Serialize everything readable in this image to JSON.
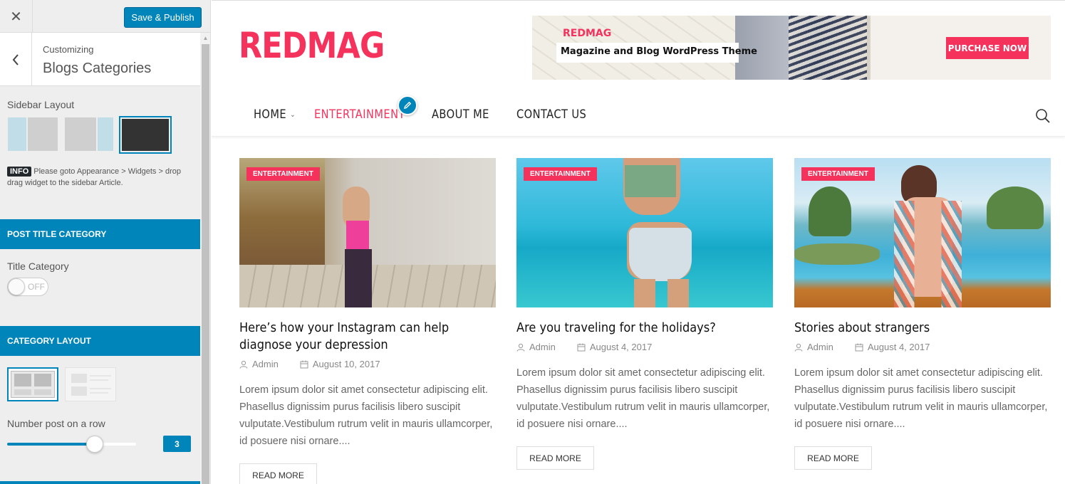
{
  "customizer": {
    "close_icon": "✕",
    "publish_label": "Save & Publish",
    "breadcrumb": "Customizing",
    "section_title": "Blogs Categories",
    "sidebar_layout": {
      "title": "Sidebar Layout",
      "options": [
        "left-sidebar",
        "right-sidebar",
        "no-sidebar"
      ],
      "selected": "no-sidebar"
    },
    "info": {
      "badge": "INFO",
      "text": "Please goto Appearance > Widgets > drop drag widget to the sidebar Article."
    },
    "post_title_category": {
      "heading": "POST TITLE CATEGORY",
      "control_title": "Title Category",
      "toggle_label": "OFF",
      "toggle_on": false
    },
    "category_layout": {
      "heading": "CATEGORY LAYOUT",
      "options": [
        "grid",
        "list"
      ],
      "selected": "grid"
    },
    "number_post": {
      "title": "Number post on a row",
      "value": "3",
      "fill_fraction": 0.68
    },
    "accent_color": "#0085ba"
  },
  "site": {
    "logo": "REDMAG",
    "brand_color": "#f5325c",
    "banner": {
      "brand": "REDMAG",
      "tagline": "Magazine and Blog WordPress Theme",
      "button": "PURCHASE NOW"
    },
    "nav": {
      "items": [
        {
          "label": "HOME",
          "has_dropdown": true
        },
        {
          "label": "ENTERTAINMENT",
          "active": true
        },
        {
          "label": "ABOUT ME"
        },
        {
          "label": "CONTACT US"
        }
      ]
    },
    "posts": [
      {
        "category": "ENTERTAINMENT",
        "title": "Here’s how your Instagram can help diagnose your depression",
        "author": "Admin",
        "date": "August 10, 2017",
        "excerpt": "Lorem ipsum dolor sit amet consectetur adipiscing elit. Phasellus dignissim purus facilisis libero suscipit vulputate.Vestibulum rutrum velit in mauris ullamcorper, id posuere nisi ornare....",
        "read_more": "READ MORE"
      },
      {
        "category": "ENTERTAINMENT",
        "title": "Are you traveling for the holidays?",
        "author": "Admin",
        "date": "August 4, 2017",
        "excerpt": "Lorem ipsum dolor sit amet consectetur adipiscing elit. Phasellus dignissim purus facilisis libero suscipit vulputate.Vestibulum rutrum velit in mauris ullamcorper, id posuere nisi ornare....",
        "read_more": "READ MORE"
      },
      {
        "category": "ENTERTAINMENT",
        "title": "Stories about strangers",
        "author": "Admin",
        "date": "August 4, 2017",
        "excerpt": "Lorem ipsum dolor sit amet consectetur adipiscing elit. Phasellus dignissim purus facilisis libero suscipit vulputate.Vestibulum rutrum velit in mauris ullamcorper, id posuere nisi ornare....",
        "read_more": "READ MORE"
      }
    ]
  }
}
